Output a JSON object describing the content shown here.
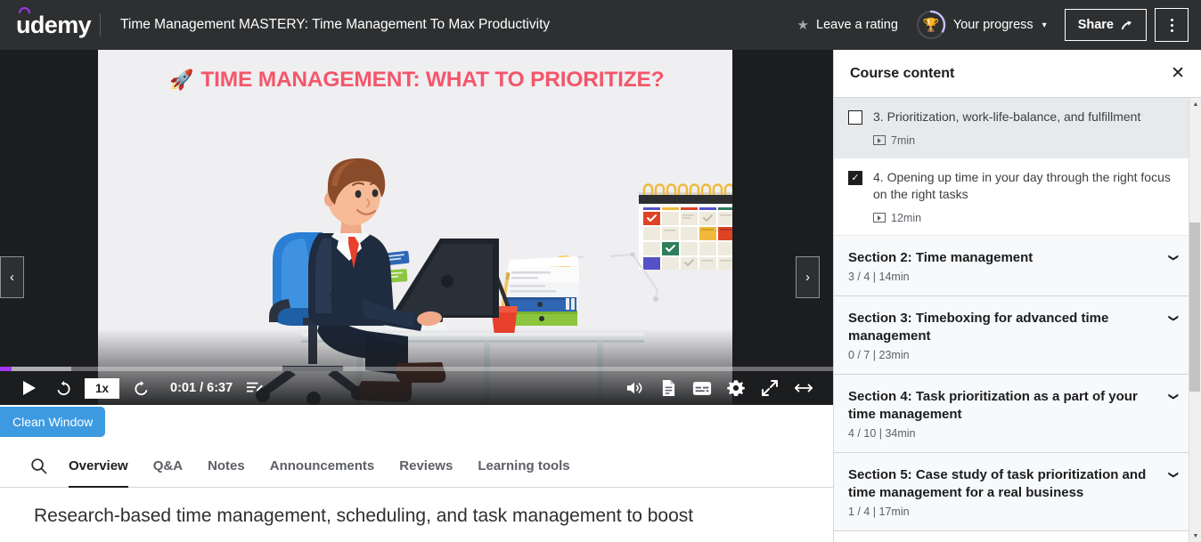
{
  "header": {
    "logo_text": "udemy",
    "logo_name": "udemy-logo",
    "course_title": "Time Management MASTERY: Time Management To Max Productivity",
    "rating_label": "Leave a rating",
    "star_icon": "star-icon",
    "progress_label": "Your progress",
    "progress_icon": "trophy-icon",
    "progress_chevron": "⌄",
    "share_label": "Share",
    "share_icon": "↗",
    "more_icon": "kebab-menu-icon"
  },
  "video": {
    "slide_title": "TIME MANAGEMENT: WHAT TO PRIORITIZE?",
    "slide_title_color": "#f4566a",
    "rocket_icon": "🚀",
    "prev_arrow": "‹",
    "next_arrow": "›",
    "play_icon": "play-icon",
    "rewind_label": "rewind-5s-icon",
    "speed": "1x",
    "forward_label": "forward-5s-icon",
    "time": "0:01 / 6:37",
    "time_current": "0:01",
    "time_total": "6:37",
    "notes_icon": "add-note-icon",
    "volume_icon": "volume-icon",
    "transcript_icon": "transcript-icon",
    "captions_icon": "captions-icon",
    "settings_icon": "gear-icon",
    "fullscreen_icon": "fullscreen-icon",
    "theater_icon": "theater-mode-icon",
    "progress_played_pct": 1.4,
    "progress_buffered_pct": 8.6,
    "played_color": "#a435f0"
  },
  "overlay": {
    "clean_window_label": "Clean Window",
    "clean_window_color": "#3d9ae0"
  },
  "tabs": {
    "search_icon": "search-icon",
    "items": [
      {
        "label": "Overview",
        "active": true
      },
      {
        "label": "Q&A",
        "active": false
      },
      {
        "label": "Notes",
        "active": false
      },
      {
        "label": "Announcements",
        "active": false
      },
      {
        "label": "Reviews",
        "active": false
      },
      {
        "label": "Learning tools",
        "active": false
      }
    ]
  },
  "overview": {
    "headline": "Research-based time management, scheduling, and task management to boost"
  },
  "sidebar": {
    "title": "Course content",
    "close_icon": "✕",
    "lectures": [
      {
        "title": "3. Prioritization, work-life-balance, and fulfillment",
        "duration": "7min",
        "checked": false,
        "current": true
      },
      {
        "title": "4. Opening up time in your day through the right focus on the right tasks",
        "duration": "12min",
        "checked": true,
        "current": false
      }
    ],
    "sections": [
      {
        "title": "Section 2: Time management",
        "meta": "3 / 4 | 14min",
        "chevron": "⌄"
      },
      {
        "title": "Section 3: Timeboxing for advanced time management",
        "meta": "0 / 7 | 23min",
        "chevron": "⌄"
      },
      {
        "title": "Section 4: Task prioritization as a part of your time management",
        "meta": "4 / 10 | 34min",
        "chevron": "⌄"
      },
      {
        "title": "Section 5: Case study of task prioritization and time management for a real business",
        "meta": "1 / 4 | 17min",
        "chevron": "⌄"
      }
    ],
    "scroll_up_icon": "▲",
    "scroll_down_icon": "▼"
  }
}
